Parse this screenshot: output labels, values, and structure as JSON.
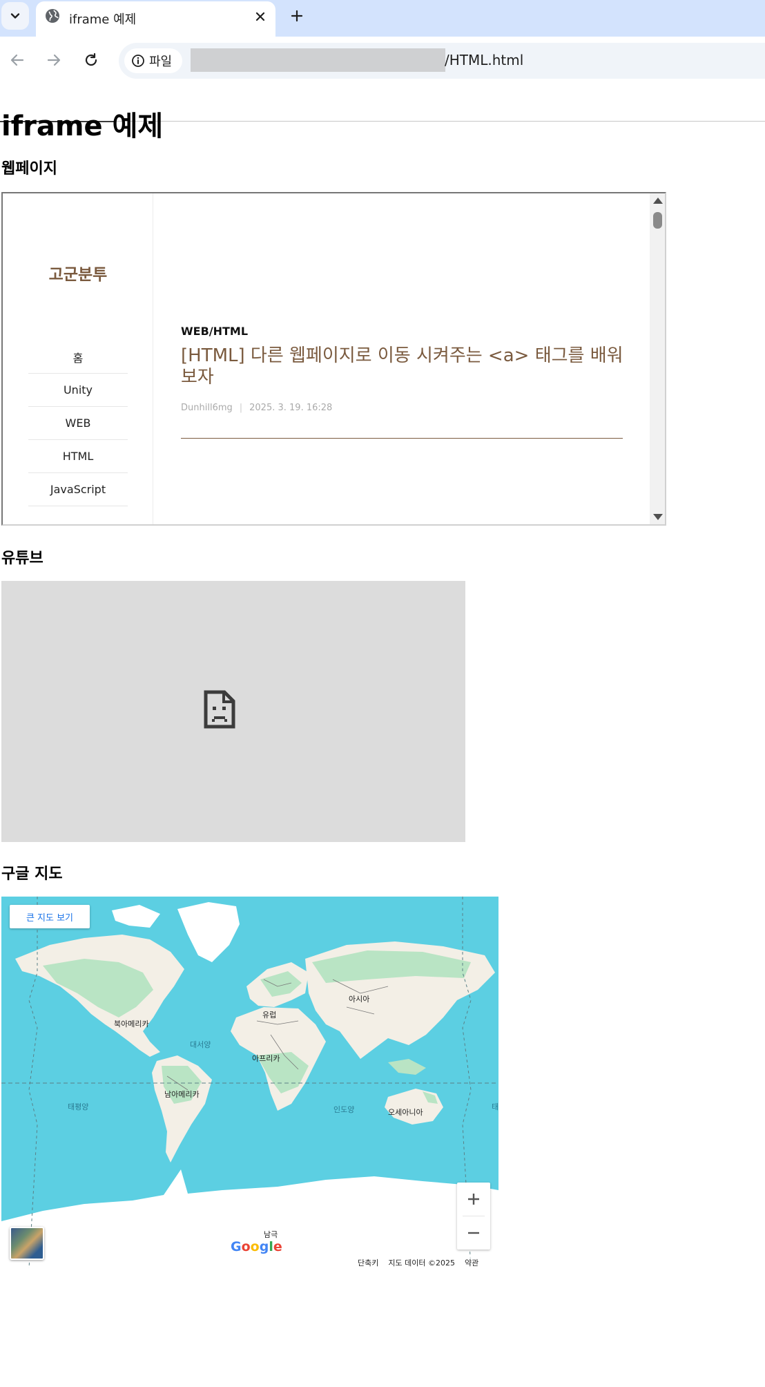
{
  "browser": {
    "tab_title": "iframe 예제",
    "site_chip_label": "파일",
    "url_visible_suffix": "/HTML.html"
  },
  "page": {
    "title": "iframe 예제",
    "sections": {
      "webpage": "웹페이지",
      "youtube": "유튜브",
      "map": "구글 지도"
    }
  },
  "blog": {
    "name": "고군분투",
    "categories": [
      "홈",
      "Unity",
      "WEB",
      "HTML",
      "JavaScript"
    ],
    "post": {
      "category": "WEB/HTML",
      "title": "[HTML] 다른 웹페이지로 이동 시켜주는 <a> 태그를 배워보자",
      "author": "Dunhill6mg",
      "date": "2025. 3. 19. 16:28"
    }
  },
  "map": {
    "view_larger_label": "큰 지도 보기",
    "labels": {
      "north_america": "북아메리카",
      "south_america": "남아메리카",
      "europe": "유럽",
      "asia": "아시아",
      "africa": "아프리카",
      "oceania": "오세아니아",
      "antarctica": "남극",
      "atlantic": "대서양",
      "pacific": "태평양",
      "indian": "인도양",
      "pacific_right": "태"
    },
    "logo": "Google",
    "footer": {
      "shortcuts": "단축키",
      "map_data": "지도 데이터 ©2025",
      "terms": "약관"
    },
    "colors": {
      "ocean": "#5ccfe2",
      "land": "#f3efe6",
      "vegetation": "#b9e4c4",
      "ice": "#ffffff"
    }
  }
}
